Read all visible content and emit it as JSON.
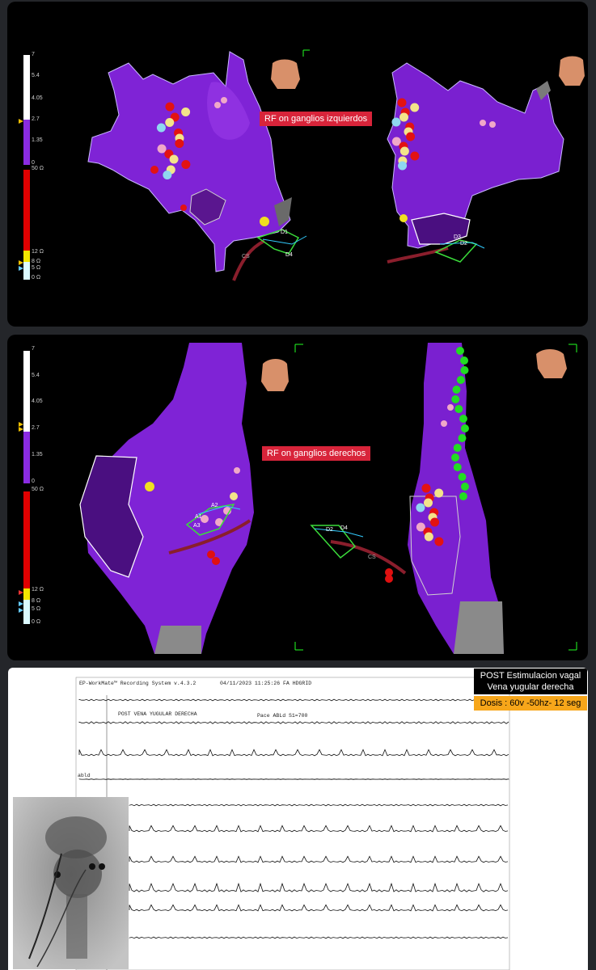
{
  "panel_top": {
    "label": "RF on ganglios izquierdos",
    "scale_ticks": [
      "7",
      "5.4",
      "4.05",
      "2.7",
      "1.35",
      "0",
      "50 Ω",
      "12 Ω",
      "8 Ω",
      "5 Ω",
      "0 Ω"
    ],
    "catheter_labels": [
      "D1",
      "D2",
      "D3",
      "D4",
      "CS"
    ]
  },
  "panel_middle": {
    "label": "RF on ganglios derechos",
    "scale_ticks": [
      "7",
      "5.4",
      "4.05",
      "2.7",
      "1.35",
      "0",
      "50 Ω",
      "12 Ω",
      "8 Ω",
      "5 Ω",
      "0 Ω"
    ],
    "catheter_labels": [
      "A1",
      "A2",
      "A3",
      "D2",
      "D4",
      "CS"
    ]
  },
  "panel_bottom": {
    "post_line1": "POST Estimulacion vagal",
    "post_line2": "Vena yugular derecha",
    "dose": "Dosis : 60v -50hz- 12 seg",
    "header_system": "EP-WorkMate™ Recording System v.4.3.2",
    "header_date": "04/11/2023 11:25:26 FA HDGRID",
    "annotation_left": "POST VENA YUGULAR DERECHA",
    "annotation_right": "Pace ABLd S1=700",
    "channel_label": "abld"
  }
}
